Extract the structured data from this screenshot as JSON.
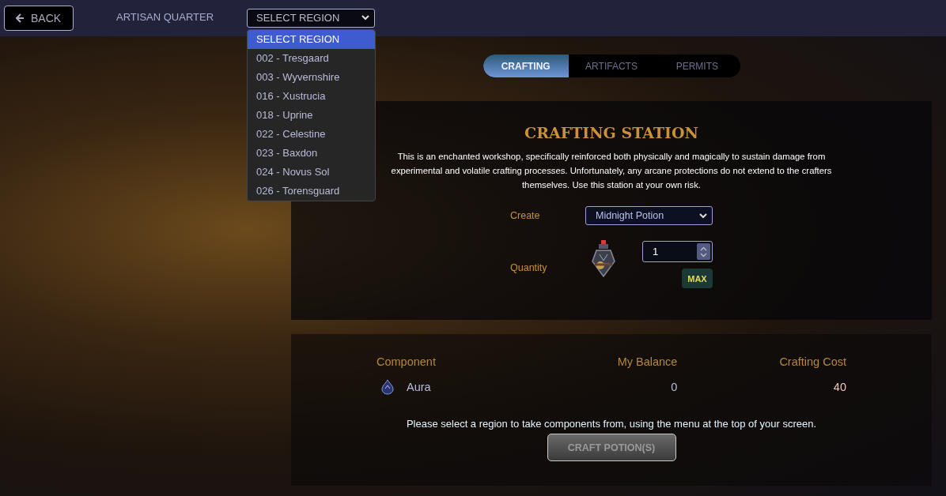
{
  "header": {
    "back_button": "BACK",
    "location": "ARTISAN QUARTER",
    "region_select": {
      "value": "SELECT REGION",
      "expanded": true,
      "options": [
        {
          "label": "SELECT REGION",
          "selected": true
        },
        {
          "label": "002 - Tresgaard",
          "selected": false
        },
        {
          "label": "003 - Wyvernshire",
          "selected": false
        },
        {
          "label": "016 - Xustrucia",
          "selected": false
        },
        {
          "label": "018 - Uprine",
          "selected": false
        },
        {
          "label": "022 - Celestine",
          "selected": false
        },
        {
          "label": "023 - Baxdon",
          "selected": false
        },
        {
          "label": "024 - Novus Sol",
          "selected": false
        },
        {
          "label": "026 - Torensguard",
          "selected": false
        }
      ]
    }
  },
  "tabs": [
    {
      "label": "CRAFTING",
      "selected": true
    },
    {
      "label": "ARTIFACTS",
      "selected": false
    },
    {
      "label": "PERMITS",
      "selected": false
    }
  ],
  "station": {
    "title": "CRAFTING STATION",
    "description": "This is an enchanted workshop, specifically reinforced both physically and magically to sustain damage from experimental and volatile crafting processes. Unfortunately, any arcane protections do not extend to the crafters themselves. Use this station at your own risk.",
    "create_label": "Create",
    "create_value": "Midnight Potion",
    "quantity_label": "Quantity",
    "quantity_value": "1",
    "max_button": "MAX"
  },
  "components": {
    "columns": [
      "Component",
      "My Balance",
      "Crafting Cost"
    ],
    "rows": [
      {
        "name": "Aura",
        "balance": "0",
        "cost": "40"
      }
    ],
    "message": "Please select a region to take components from, using the menu at the top of your screen.",
    "craft_button": {
      "label": "CRAFT POTION(S)",
      "disabled": true
    }
  }
}
